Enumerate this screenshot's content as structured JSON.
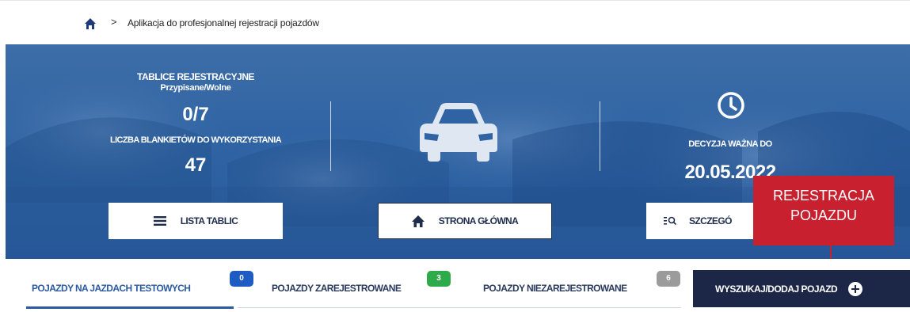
{
  "breadcrumb": {
    "separator": ">",
    "current": "Aplikacja do profesjonalnej rejestracji pojazdów"
  },
  "hero": {
    "plates_title": "TABLICE REJESTRACYJNE",
    "plates_subtitle": "Przypisane/Wolne",
    "plates_value": "0/7",
    "blanks_title": "LICZBA BLANKIETÓW DO WYKORZYSTANIA",
    "blanks_value": "47",
    "decision_label": "DECYZJA WAŻNA DO",
    "decision_date": "20.05.2022",
    "buttons": {
      "list_plates": "LISTA TABLIC",
      "home": "STRONA GŁÓWNA",
      "details": "SZCZEGÓ"
    }
  },
  "callout": {
    "line1": "REJESTRACJA",
    "line2": "POJAZDU"
  },
  "tabs": [
    {
      "label": "POJAZDY NA JAZDACH TESTOWYCH",
      "count": "0"
    },
    {
      "label": "POJAZDY ZAREJESTROWANE",
      "count": "3"
    },
    {
      "label": "POJAZDY NIEZAREJESTROWANE",
      "count": "6"
    }
  ],
  "actions": {
    "search_add": "WYSZUKAJ/DODAJ POJAZD"
  },
  "colors": {
    "hero_blue": "#2f63a3",
    "navy": "#1c2646",
    "accent_red": "#c8202f",
    "badge_blue": "#1e5cc4",
    "badge_green": "#2faa4a",
    "badge_gray": "#9b9b9b"
  }
}
